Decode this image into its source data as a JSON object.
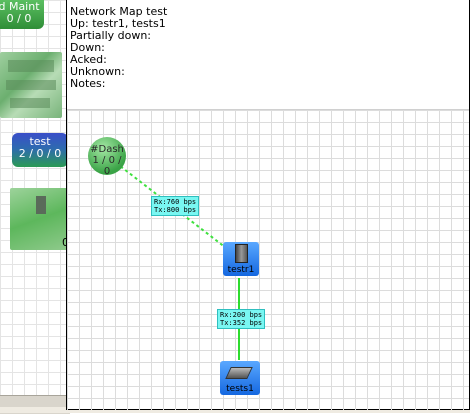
{
  "background": {
    "maint_node": {
      "label": "d Maint",
      "counts": "0 / 0"
    },
    "test_node": {
      "label": "test",
      "counts": "2 / 0 / 0"
    },
    "right_status_digit": "0"
  },
  "popup": {
    "title": "Network Map test",
    "lines": {
      "up": "Up: testr1, tests1",
      "partially_down": "Partially down:",
      "down": "Down:",
      "acked": "Acked:",
      "unknown": "Unknown:",
      "notes": "Notes:"
    }
  },
  "map": {
    "dash_node": {
      "label": "#Dash",
      "counts": "1 / 0 / 0",
      "color": "#3aa346"
    },
    "hosts": [
      {
        "label": "testr1",
        "icon": "server-tower-icon"
      },
      {
        "label": "tests1",
        "icon": "switch-device-icon"
      }
    ],
    "links": [
      {
        "rx": "Rx:760 bps",
        "tx": "Tx:800 bps",
        "style": "dotted",
        "color": "#3fe03f"
      },
      {
        "rx": "Rx:200 bps",
        "tx": "Tx:352 bps",
        "style": "solid",
        "color": "#2edc2e"
      }
    ]
  }
}
